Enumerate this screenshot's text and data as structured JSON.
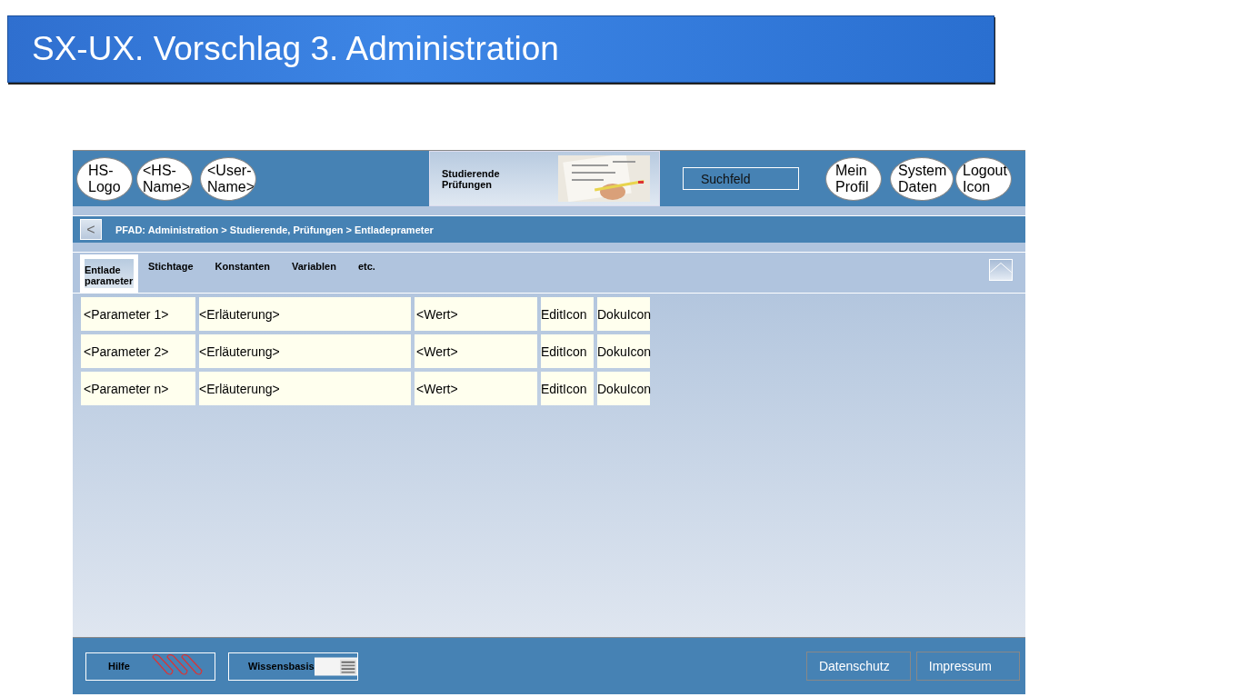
{
  "title": "SX-UX. Vorschlag 3. Administration",
  "header": {
    "badges": [
      {
        "label": "HS- Logo"
      },
      {
        "label": "<HS- Name>"
      },
      {
        "label": "<User- Name>"
      }
    ],
    "nav_tile": {
      "label": "Studierende Prüfungen",
      "kind": "picture"
    },
    "search": {
      "placeholder": "Suchfeld"
    },
    "actions": [
      {
        "label": "Mein Profil"
      },
      {
        "label": "System Daten"
      },
      {
        "label": "Logout Icon"
      }
    ]
  },
  "breadcrumb": {
    "back": "<",
    "text": "PFAD: Administration > Studierende, Prüfungen > Entladeprameter"
  },
  "tabs": [
    {
      "label": "Entlade parameter",
      "selected": true
    },
    {
      "label": "Stichtage",
      "selected": false
    },
    {
      "label": "Konstanten",
      "selected": false
    },
    {
      "label": "Variablen",
      "selected": false
    },
    {
      "label": "etc.",
      "selected": false
    }
  ],
  "rows": [
    {
      "parameter": "<Parameter 1>",
      "explanation": "<Erläuterung>",
      "value": "<Wert>",
      "edit": "EditIcon",
      "doku": "DokuIcon"
    },
    {
      "parameter": "<Parameter 2>",
      "explanation": "<Erläuterung>",
      "value": "<Wert>",
      "edit": "EditIcon",
      "doku": "DokuIcon"
    },
    {
      "parameter": "<Parameter n>",
      "explanation": "<Erläuterung>",
      "value": "<Wert>",
      "edit": "EditIcon",
      "doku": "DokuIcon"
    }
  ],
  "footer": {
    "left": [
      {
        "label": "Hilfe",
        "kind": "clips"
      },
      {
        "label": "Wissensbasis",
        "kind": "picture"
      }
    ],
    "right": [
      {
        "label": "Datenschutz"
      },
      {
        "label": "Impressum"
      }
    ]
  }
}
